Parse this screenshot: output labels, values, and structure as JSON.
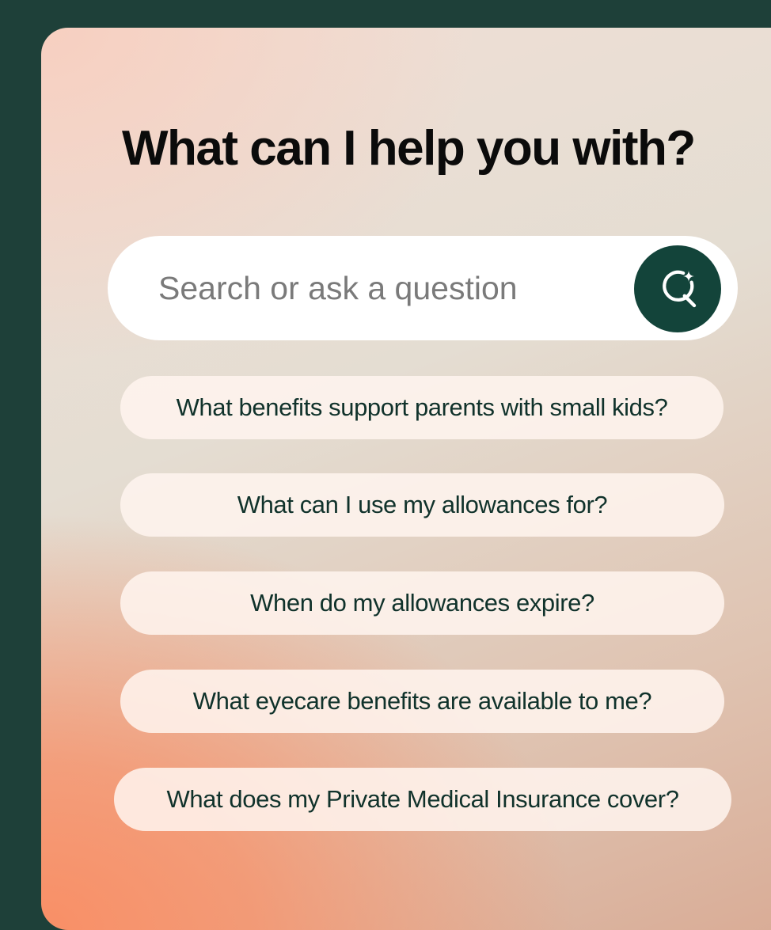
{
  "heading": "What can I help you with?",
  "search": {
    "placeholder": "Search or ask a question",
    "button_icon": "ai-search-icon",
    "button_color": "#13443a"
  },
  "suggestions": [
    "What benefits support parents with small kids?",
    "What can I use my allowances for?",
    "When do my allowances expire?",
    "What eyecare benefits are available to me?",
    "What does my Private Medical Insurance cover?"
  ],
  "colors": {
    "frame_background": "#1e4039",
    "accent": "#13443a",
    "chip_text": "#10322b",
    "gradient_warm": "#f98f66"
  }
}
